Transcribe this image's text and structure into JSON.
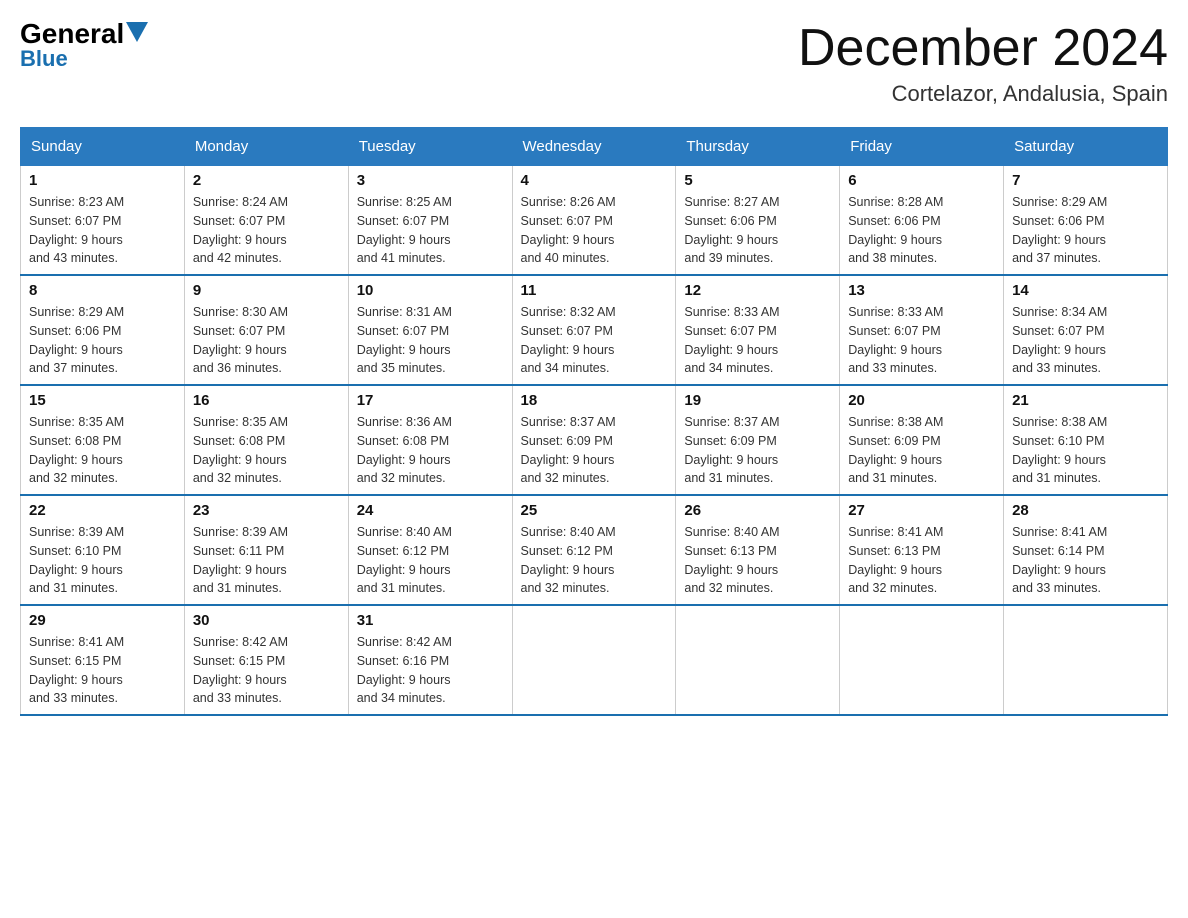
{
  "logo": {
    "general": "General",
    "blue": "Blue"
  },
  "title": "December 2024",
  "subtitle": "Cortelazor, Andalusia, Spain",
  "headers": [
    "Sunday",
    "Monday",
    "Tuesday",
    "Wednesday",
    "Thursday",
    "Friday",
    "Saturday"
  ],
  "weeks": [
    [
      {
        "day": "1",
        "sunrise": "8:23 AM",
        "sunset": "6:07 PM",
        "daylight": "9 hours and 43 minutes."
      },
      {
        "day": "2",
        "sunrise": "8:24 AM",
        "sunset": "6:07 PM",
        "daylight": "9 hours and 42 minutes."
      },
      {
        "day": "3",
        "sunrise": "8:25 AM",
        "sunset": "6:07 PM",
        "daylight": "9 hours and 41 minutes."
      },
      {
        "day": "4",
        "sunrise": "8:26 AM",
        "sunset": "6:07 PM",
        "daylight": "9 hours and 40 minutes."
      },
      {
        "day": "5",
        "sunrise": "8:27 AM",
        "sunset": "6:06 PM",
        "daylight": "9 hours and 39 minutes."
      },
      {
        "day": "6",
        "sunrise": "8:28 AM",
        "sunset": "6:06 PM",
        "daylight": "9 hours and 38 minutes."
      },
      {
        "day": "7",
        "sunrise": "8:29 AM",
        "sunset": "6:06 PM",
        "daylight": "9 hours and 37 minutes."
      }
    ],
    [
      {
        "day": "8",
        "sunrise": "8:29 AM",
        "sunset": "6:06 PM",
        "daylight": "9 hours and 37 minutes."
      },
      {
        "day": "9",
        "sunrise": "8:30 AM",
        "sunset": "6:07 PM",
        "daylight": "9 hours and 36 minutes."
      },
      {
        "day": "10",
        "sunrise": "8:31 AM",
        "sunset": "6:07 PM",
        "daylight": "9 hours and 35 minutes."
      },
      {
        "day": "11",
        "sunrise": "8:32 AM",
        "sunset": "6:07 PM",
        "daylight": "9 hours and 34 minutes."
      },
      {
        "day": "12",
        "sunrise": "8:33 AM",
        "sunset": "6:07 PM",
        "daylight": "9 hours and 34 minutes."
      },
      {
        "day": "13",
        "sunrise": "8:33 AM",
        "sunset": "6:07 PM",
        "daylight": "9 hours and 33 minutes."
      },
      {
        "day": "14",
        "sunrise": "8:34 AM",
        "sunset": "6:07 PM",
        "daylight": "9 hours and 33 minutes."
      }
    ],
    [
      {
        "day": "15",
        "sunrise": "8:35 AM",
        "sunset": "6:08 PM",
        "daylight": "9 hours and 32 minutes."
      },
      {
        "day": "16",
        "sunrise": "8:35 AM",
        "sunset": "6:08 PM",
        "daylight": "9 hours and 32 minutes."
      },
      {
        "day": "17",
        "sunrise": "8:36 AM",
        "sunset": "6:08 PM",
        "daylight": "9 hours and 32 minutes."
      },
      {
        "day": "18",
        "sunrise": "8:37 AM",
        "sunset": "6:09 PM",
        "daylight": "9 hours and 32 minutes."
      },
      {
        "day": "19",
        "sunrise": "8:37 AM",
        "sunset": "6:09 PM",
        "daylight": "9 hours and 31 minutes."
      },
      {
        "day": "20",
        "sunrise": "8:38 AM",
        "sunset": "6:09 PM",
        "daylight": "9 hours and 31 minutes."
      },
      {
        "day": "21",
        "sunrise": "8:38 AM",
        "sunset": "6:10 PM",
        "daylight": "9 hours and 31 minutes."
      }
    ],
    [
      {
        "day": "22",
        "sunrise": "8:39 AM",
        "sunset": "6:10 PM",
        "daylight": "9 hours and 31 minutes."
      },
      {
        "day": "23",
        "sunrise": "8:39 AM",
        "sunset": "6:11 PM",
        "daylight": "9 hours and 31 minutes."
      },
      {
        "day": "24",
        "sunrise": "8:40 AM",
        "sunset": "6:12 PM",
        "daylight": "9 hours and 31 minutes."
      },
      {
        "day": "25",
        "sunrise": "8:40 AM",
        "sunset": "6:12 PM",
        "daylight": "9 hours and 32 minutes."
      },
      {
        "day": "26",
        "sunrise": "8:40 AM",
        "sunset": "6:13 PM",
        "daylight": "9 hours and 32 minutes."
      },
      {
        "day": "27",
        "sunrise": "8:41 AM",
        "sunset": "6:13 PM",
        "daylight": "9 hours and 32 minutes."
      },
      {
        "day": "28",
        "sunrise": "8:41 AM",
        "sunset": "6:14 PM",
        "daylight": "9 hours and 33 minutes."
      }
    ],
    [
      {
        "day": "29",
        "sunrise": "8:41 AM",
        "sunset": "6:15 PM",
        "daylight": "9 hours and 33 minutes."
      },
      {
        "day": "30",
        "sunrise": "8:42 AM",
        "sunset": "6:15 PM",
        "daylight": "9 hours and 33 minutes."
      },
      {
        "day": "31",
        "sunrise": "8:42 AM",
        "sunset": "6:16 PM",
        "daylight": "9 hours and 34 minutes."
      },
      null,
      null,
      null,
      null
    ]
  ]
}
